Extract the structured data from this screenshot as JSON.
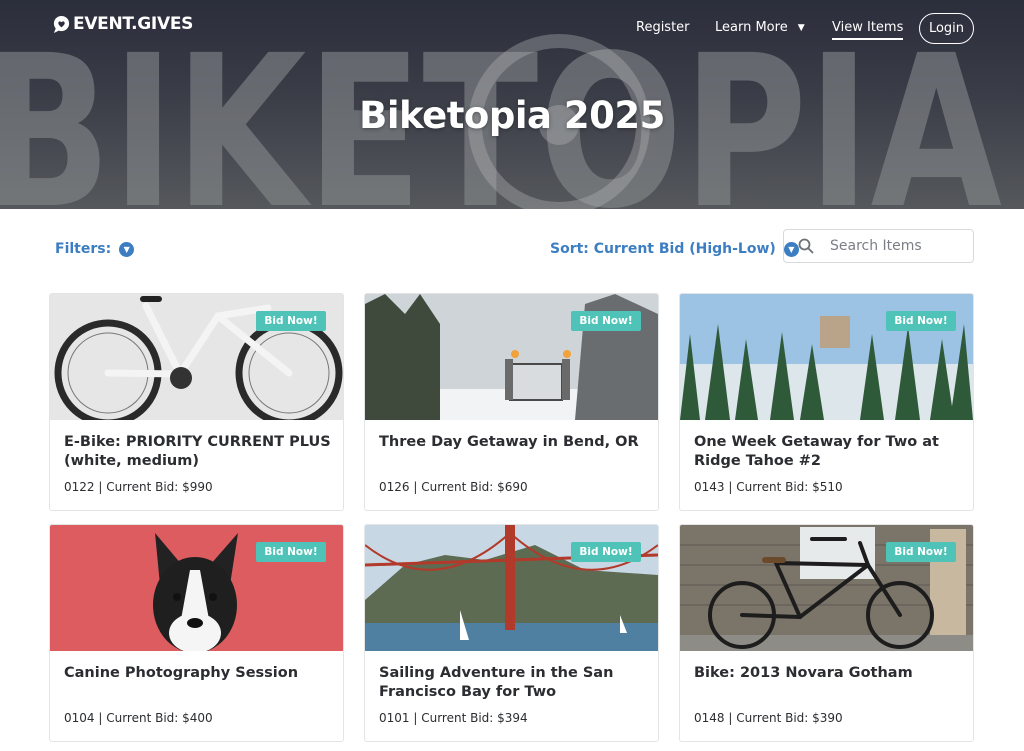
{
  "brand": {
    "name": "EVENT.GIVES"
  },
  "nav": {
    "register": "Register",
    "learn_more": "Learn More",
    "view_items": "View Items",
    "login": "Login"
  },
  "hero": {
    "title": "Biketopia 2025",
    "background_word": "BIKETOPIA"
  },
  "toolbar": {
    "filters_label": "Filters:",
    "sort_label": "Sort: Current Bid (High-Low)",
    "search_placeholder": "Search Items"
  },
  "badge_label": "Bid Now!",
  "items": [
    {
      "title": "E-Bike: PRIORITY CURRENT PLUS (white, medium)",
      "meta": "0122 | Current Bid: $990",
      "image": "white-ebike"
    },
    {
      "title": "Three Day Getaway in Bend, OR",
      "meta": "0126 | Current Bid: $690",
      "image": "snowy-gate"
    },
    {
      "title": "One Week Getaway for Two at Ridge Tahoe #2",
      "meta": "0143 | Current Bid: $510",
      "image": "tahoe-resort"
    },
    {
      "title": "Canine Photography Session",
      "meta": "0104 | Current Bid: $400",
      "image": "boston-terrier"
    },
    {
      "title": "Sailing Adventure in the San Francisco Bay for Two",
      "meta": "0101 | Current Bid: $394",
      "image": "golden-gate"
    },
    {
      "title": "Bike: 2013 Novara Gotham",
      "meta": "0148 | Current Bid: $390",
      "image": "black-bike"
    }
  ],
  "colors": {
    "accent": "#3d7ec2",
    "badge": "#4fc3b7",
    "text": "#2b2d31"
  }
}
